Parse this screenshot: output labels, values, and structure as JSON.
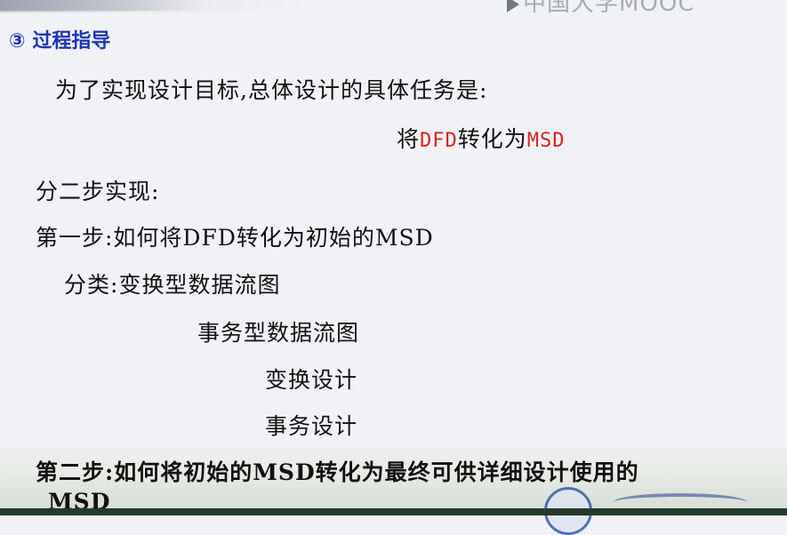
{
  "watermark": "中国大学MOOC",
  "section": {
    "number": "③",
    "title": "过程指导"
  },
  "intro": "为了实现设计目标,总体设计的具体任务是:",
  "task": {
    "p1": "将",
    "a": "DFD",
    "p2": "转化为",
    "b": "MSD"
  },
  "steps_intro": "分二步实现:",
  "step1": "第一步:如何将DFD转化为初始的MSD",
  "classify": {
    "label": "分类:",
    "item1": "变换型数据流图",
    "item2": "事务型数据流图",
    "design1": "变换设计",
    "design2": "事务设计"
  },
  "step2": {
    "prefix": "第二步:如何将初始的",
    "msd1": "MSD",
    "suffix": "转化为最终可供详细设计使用的",
    "msd2": "MSD"
  },
  "colors": {
    "title_blue": "#1f35b5",
    "highlight_red": "#d8232a",
    "background": "#f1f2f6"
  }
}
